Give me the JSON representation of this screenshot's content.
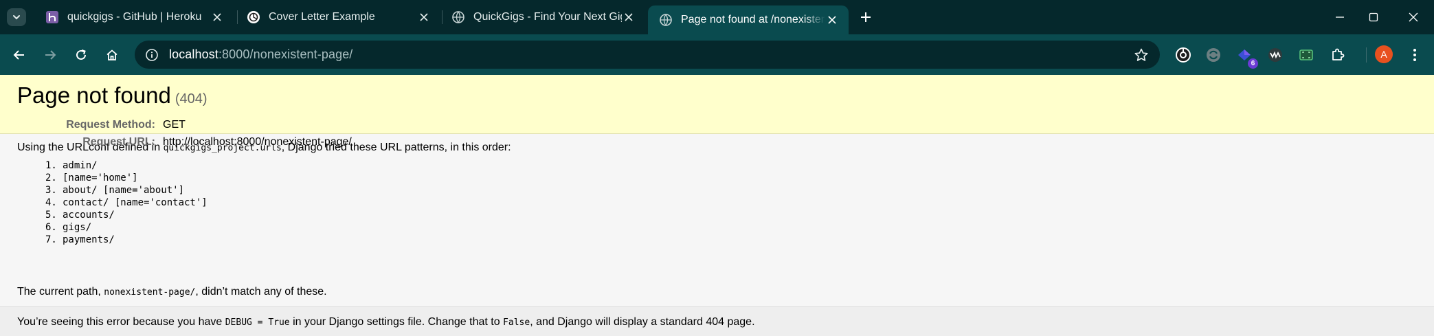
{
  "browser": {
    "tabs": [
      {
        "title": "quickgigs - GitHub | Heroku",
        "icon": "heroku-icon"
      },
      {
        "title": "Cover Letter Example",
        "icon": "openai-icon"
      },
      {
        "title": "QuickGigs - Find Your Next Gig",
        "icon": "globe-icon"
      },
      {
        "title": "Page not found at /nonexistent-page/",
        "icon": "globe-icon",
        "active": true
      }
    ],
    "url_host": "localhost",
    "url_rest": ":8000/nonexistent-page/",
    "extension_badge": "6",
    "profile_initial": "A",
    "colors": {
      "frame": "#05282c",
      "toolbar": "#0a4b4f",
      "profile": "#e8511f"
    }
  },
  "page": {
    "title": "Page not found",
    "status_code": "(404)",
    "request_method_label": "Request Method:",
    "request_method": "GET",
    "request_url_label": "Request URL:",
    "request_url": "http://localhost:8000/nonexistent-page/",
    "urlconf_intro_before": "Using the URLconf defined in ",
    "urlconf_module": "quickgigs_project.urls",
    "urlconf_intro_after": ", Django tried these URL patterns, in this order:",
    "patterns": [
      "admin/",
      "[name='home']",
      "about/ [name='about']",
      "contact/ [name='contact']",
      "accounts/",
      "gigs/",
      "payments/"
    ],
    "current_path_before": "The current path, ",
    "current_path": "nonexistent-page/",
    "current_path_after": ", didn’t match any of these.",
    "debug_before": "You’re seeing this error because you have ",
    "debug_code": "DEBUG = True",
    "debug_middle": " in your Django settings file. Change that to ",
    "debug_false": "False",
    "debug_after": ", and Django will display a standard 404 page.",
    "colors": {
      "summary_bg": "#ffffcc",
      "info_bg": "#f6f6f6",
      "explanation_bg": "#eeeeee"
    }
  }
}
